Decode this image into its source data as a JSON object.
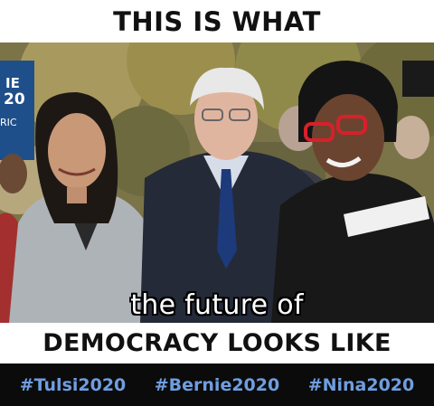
{
  "captions": {
    "top": "THIS IS WHAT",
    "overlay": "the future of",
    "bottom": "DEMOCRACY LOOKS LIKE"
  },
  "sign": {
    "line1": "IE",
    "line2": "20",
    "line3": "RIC"
  },
  "hashtags": [
    "#Tulsi2020",
    "#Bernie2020",
    "#Nina2020"
  ],
  "colors": {
    "hashtag": "#6f9ee0",
    "hashtag_bar": "#0b0b0b",
    "caption_bg": "#ffffff",
    "sign": "#1f4f8a"
  }
}
